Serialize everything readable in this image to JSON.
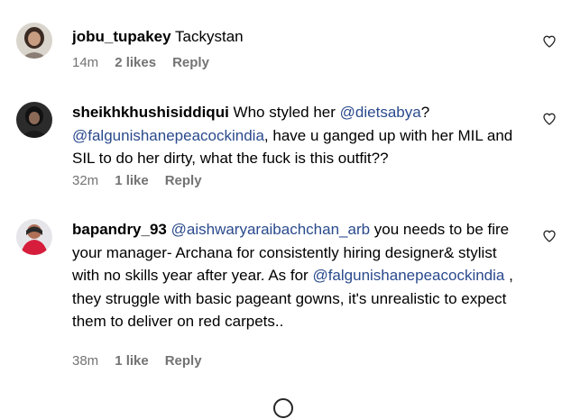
{
  "comments": [
    {
      "username": "jobu_tupakey",
      "text": "Tackystan",
      "time": "14m",
      "likes": "2 likes",
      "reply": "Reply"
    },
    {
      "username": "sheikhkhushisiddiqui",
      "text_1": "Who styled her",
      "mention_1": "@dietsabya",
      "text_2": "?",
      "mention_2": "@falgunishanepeacockindia",
      "text_3": ", have u ganged up with her MIL and SIL to do her dirty, what the fuck is this outfit??",
      "time": "32m",
      "likes": "1 like",
      "reply": "Reply"
    },
    {
      "username": "bapandry_93",
      "mention_1": "@aishwaryaraibachchan_arb",
      "text_1": "you needs to be fire your manager- Archana for consistently hiring designer& stylist with no skills year after year. As for",
      "mention_2": "@falgunishanepeacockindia",
      "text_2": ", they struggle with basic pageant gowns, it's unrealistic to expect them to deliver on red carpets..",
      "time": "38m",
      "likes": "1 like",
      "reply": "Reply"
    }
  ]
}
